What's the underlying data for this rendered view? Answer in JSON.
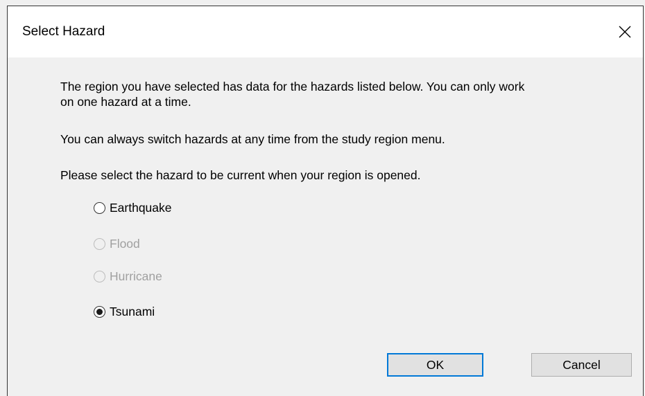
{
  "window": {
    "title": "Select Hazard",
    "close_icon": "close-icon"
  },
  "body": {
    "message1": "The region you have selected has data for the hazards listed below.  You can only work",
    "message1b": "on one hazard at a time.",
    "message2": "You can always switch hazards at any time from the study region menu.",
    "message3": "Please select the hazard to be current when your region is opened."
  },
  "hazards": [
    {
      "label": "Earthquake",
      "enabled": true,
      "selected": false
    },
    {
      "label": "Flood",
      "enabled": false,
      "selected": false
    },
    {
      "label": "Hurricane",
      "enabled": false,
      "selected": false
    },
    {
      "label": "Tsunami",
      "enabled": true,
      "selected": true
    }
  ],
  "buttons": {
    "ok_label": "OK",
    "cancel_label": "Cancel"
  },
  "colors": {
    "accent": "#0078d7",
    "disabled_text": "#a0a0a0"
  }
}
